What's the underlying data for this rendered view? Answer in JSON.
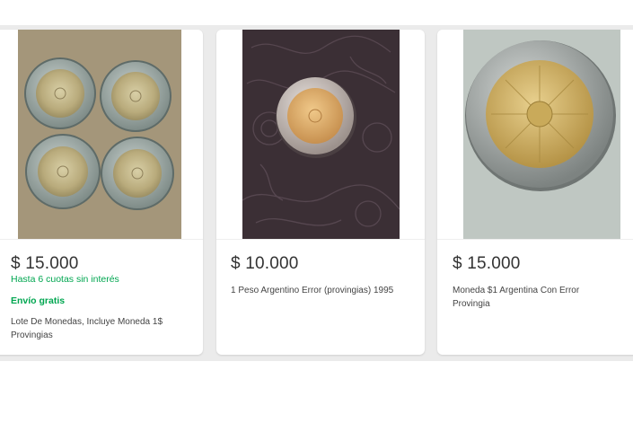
{
  "listings": [
    {
      "price": "$ 15.000",
      "installments": "Hasta 6 cuotas sin interés",
      "shipping": "Envío gratis",
      "title_line1": "Lote De Monedas, Incluye Moneda 1$",
      "title_line2": "Provingias",
      "image": "four-bimetallic-1-peso-coins"
    },
    {
      "price": "$ 10.000",
      "title_line1": "1 Peso Argentino Error (provingias) 1995",
      "image": "single-1-peso-coin-on-leather"
    },
    {
      "price": "$ 15.000",
      "title_line1": "Moneda $1 Argentina Con Error",
      "title_line2": "Provingia",
      "image": "1-peso-coin-closeup"
    }
  ],
  "colors": {
    "accent_green": "#00a650",
    "price_text": "#333333",
    "background": "#ebebeb"
  }
}
